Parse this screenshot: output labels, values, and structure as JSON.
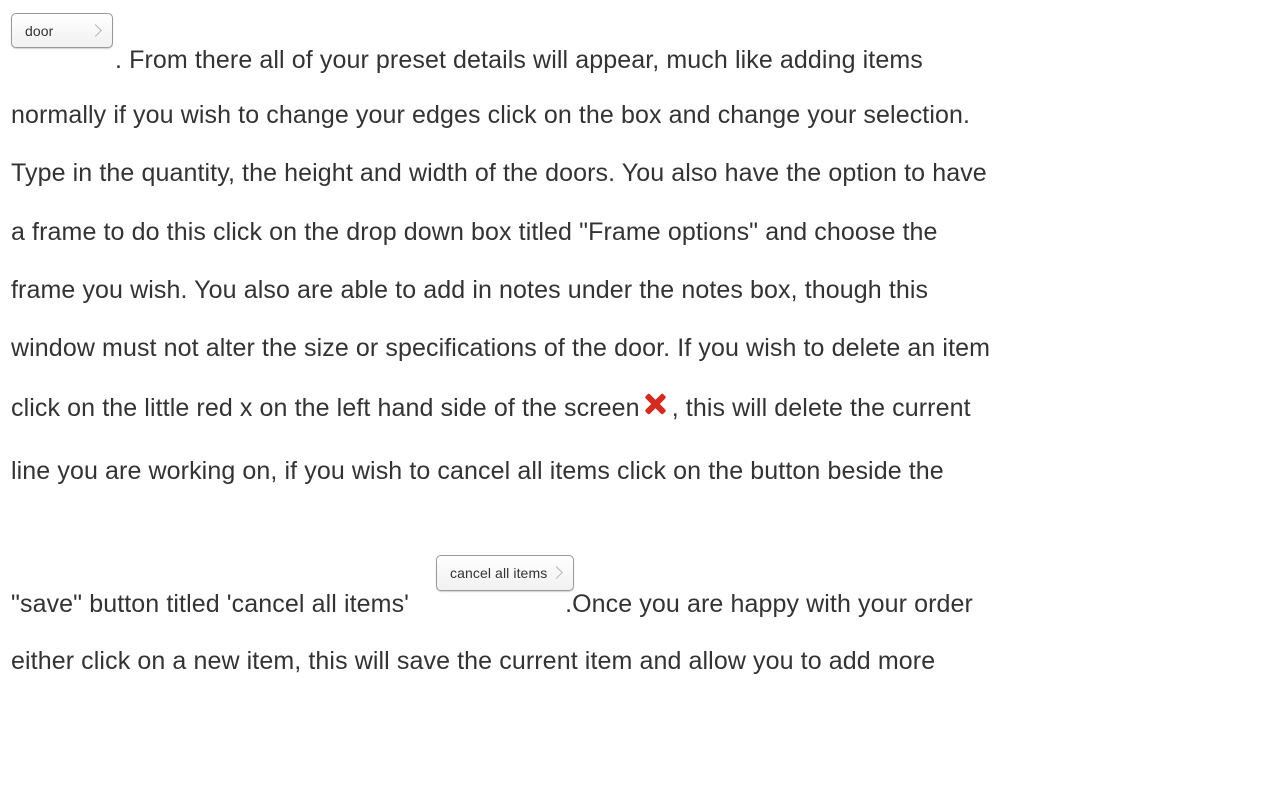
{
  "buttons": {
    "door_label": "door",
    "cancel_all_items_label": "cancel all items"
  },
  "icons": {
    "delete_icon": "red-x-icon",
    "delete_icon_color": "#d32b1e"
  },
  "text": {
    "line1": ". From there all of your preset details will appear, much like adding items",
    "line2": "normally if you wish to change your edges click on the box and change your selection.",
    "line3": "Type in the quantity, the height and width of the doors. You also have the option to have",
    "line4": "a frame to do this click on the drop down box titled \"Frame options\" and choose the",
    "line5": "frame you wish. You also are able to add in notes under the notes box, though this",
    "line6": "window must not alter the size or specifications of the door. If you wish to delete an item",
    "line7_before_icon": "click on the little red x on the left hand side of the screen",
    "line7_after_icon": ", this will delete the current",
    "line8": "line you are working on, if you wish to cancel all items click on the button beside the",
    "line9_before_button": "\"save\" button titled 'cancel all items'",
    "line9_after_button": ".Once you are happy with your order",
    "line10": "either click on a new item, this will save the current item and allow you to add more"
  }
}
